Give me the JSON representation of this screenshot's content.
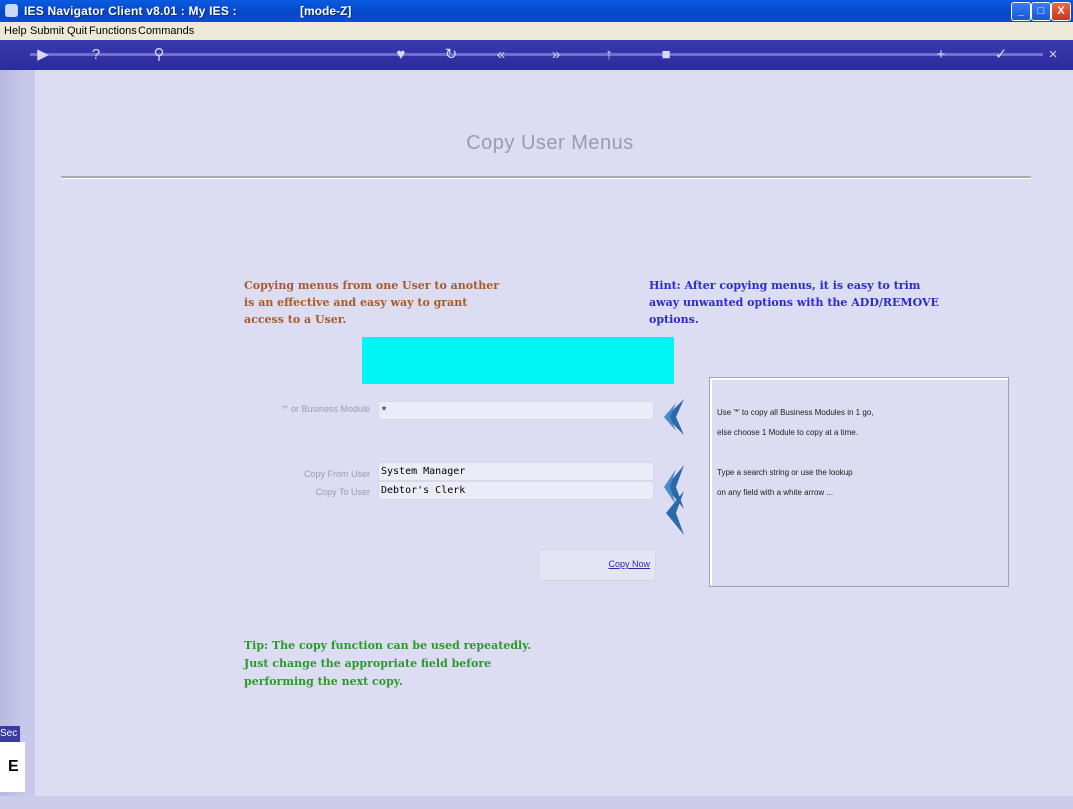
{
  "window": {
    "title": "IES Navigator Client v8.01 : My IES :",
    "mode": "[mode-Z]",
    "minimize": "_",
    "maximize": "□",
    "close": "X"
  },
  "menu": {
    "items": [
      "Help",
      "Submit",
      "Quit",
      "Functions",
      "Commands"
    ]
  },
  "toolbar": {
    "icons": [
      "play-icon",
      "help-icon",
      "search-icon",
      "heart-icon",
      "refresh-icon",
      "rewind-icon",
      "forward-icon",
      "up-icon",
      "stop-icon",
      "add-icon",
      "check-icon",
      "close-icon"
    ]
  },
  "page": {
    "title": "Copy User Menus",
    "intro": "Copying menus from one User to another\nis an effective and easy way to grant\naccess to a User.",
    "hint": "Hint: After copying menus, it is easy to trim\naway unwanted options with the ADD/REMOVE\noptions.",
    "tip": "Tip: The copy function can be used repeatedly.\nJust change the appropriate field before\nperforming the next copy."
  },
  "form": {
    "business_module": {
      "label": "'*' or Business Module",
      "value": "*"
    },
    "copy_from": {
      "label": "Copy From User",
      "value": "System Manager"
    },
    "copy_to": {
      "label": "Copy To User",
      "value": "Debtor's Clerk"
    },
    "copy_now": "Copy Now"
  },
  "info": {
    "module_help": "Use '*' to copy all Business Modules in 1 go,\nelse choose 1 Module to copy at a time.",
    "lookup_help": "Type a search string or use the lookup\non any field with a white arrow ..."
  },
  "sidebar": {
    "section_label": "Sec",
    "letter": "E"
  },
  "colors": {
    "background": "#dcdcf2",
    "accent_cyan": "#00f5f5",
    "intro_text": "#a85a28",
    "hint_text": "#2a2ad8",
    "tip_text": "#2a9a2a",
    "arrow": "#2a6aa8"
  }
}
